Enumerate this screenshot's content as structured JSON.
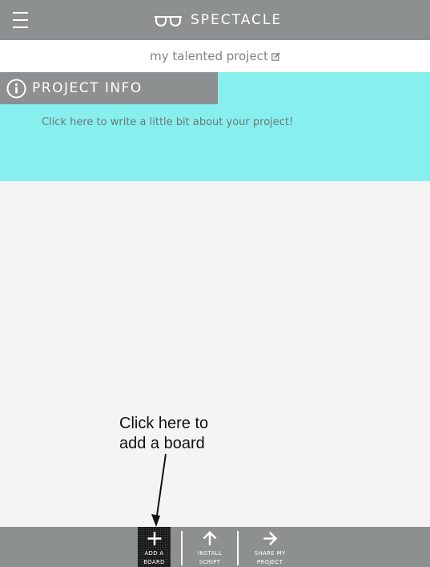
{
  "header": {
    "app_name": "SPECTACLE",
    "menu_icon": "hamburger-menu-icon",
    "logo_icon": "glasses-logo-icon"
  },
  "project": {
    "name": "my talented project",
    "edit_icon": "edit-icon"
  },
  "project_info": {
    "title": "PROJECT INFO",
    "icon": "info-icon",
    "description_placeholder": "Click here to write a little bit about your project!"
  },
  "annotation": {
    "line1": "Click here to",
    "line2": "add a board"
  },
  "bottom_bar": {
    "add_board": {
      "line1": "ADD A",
      "line2": "BOARD",
      "icon": "plus-icon"
    },
    "install_script": {
      "line1": "INSTALL",
      "line2": "SCRIPT",
      "icon": "arrow-up-icon"
    },
    "share_project": {
      "line1": "SHARE MY",
      "line2": "PROJECT",
      "icon": "arrow-right-icon"
    }
  },
  "colors": {
    "bar_gray": "#8c9090",
    "info_cyan": "#87f0ee",
    "page_bg": "#f4f4f4",
    "text_gray": "#7f8484"
  }
}
